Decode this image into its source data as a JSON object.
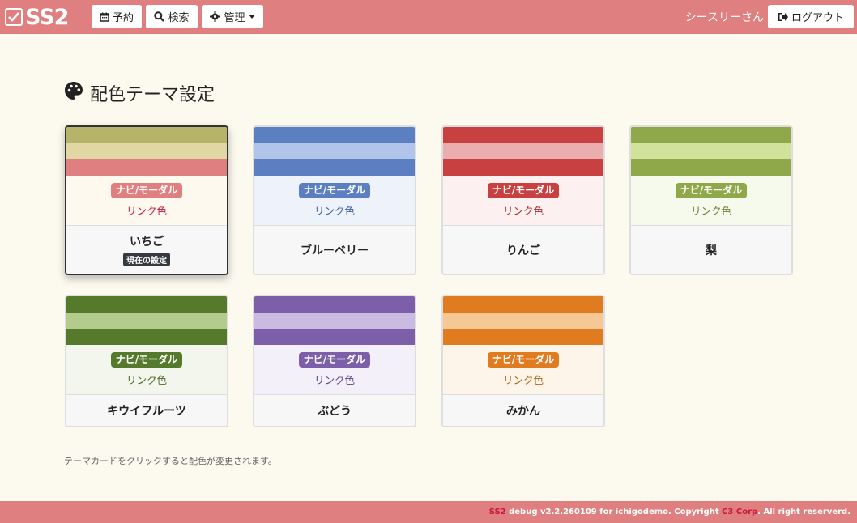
{
  "nav": {
    "logo_text": "SS2",
    "reserve_label": "予約",
    "search_label": "検索",
    "admin_label": "管理",
    "user_name": "シースリーさん",
    "logout_label": "ログアウト"
  },
  "page": {
    "title": "配色テーマ設定",
    "hint": "テーマカードをクリックすると配色が変更されます。"
  },
  "themes": [
    {
      "name": "いちご",
      "badge": "ナビ/モーダル",
      "link": "リンク色",
      "current_label": "現在の設定",
      "stripe1": "#b5b46a",
      "stripe2": "#e0d7a4",
      "stripe3": "#e07f80",
      "body_bg": "#fdf9ee",
      "badge_bg": "#e07f80",
      "link_color": "#c7183c"
    },
    {
      "name": "ブルーベリー",
      "badge": "ナビ/モーダル",
      "link": "リンク色",
      "stripe1": "#5b7fc1",
      "stripe2": "#b3c4ea",
      "stripe3": "#5b7fc1",
      "body_bg": "#eef2fb",
      "badge_bg": "#5b7fc1",
      "link_color": "#3e5f9a"
    },
    {
      "name": "りんご",
      "badge": "ナビ/モーダル",
      "link": "リンク色",
      "stripe1": "#c94040",
      "stripe2": "#ebaeae",
      "stripe3": "#c94040",
      "body_bg": "#fdf0f0",
      "badge_bg": "#c94040",
      "link_color": "#a82c2c"
    },
    {
      "name": "梨",
      "badge": "ナビ/モーダル",
      "link": "リンク色",
      "stripe1": "#8ea84a",
      "stripe2": "#d1e39a",
      "stripe3": "#8ea84a",
      "body_bg": "#f6faec",
      "badge_bg": "#8ea84a",
      "link_color": "#6a7e35"
    },
    {
      "name": "キウイフルーツ",
      "badge": "ナビ/モーダル",
      "link": "リンク色",
      "stripe1": "#567a2c",
      "stripe2": "#b3cc8e",
      "stripe3": "#567a2c",
      "body_bg": "#f2f6ec",
      "badge_bg": "#567a2c",
      "link_color": "#4a6a26"
    },
    {
      "name": "ぶどう",
      "badge": "ナビ/モーダル",
      "link": "リンク色",
      "stripe1": "#7c5fa8",
      "stripe2": "#cbbbe3",
      "stripe3": "#7c5fa8",
      "body_bg": "#f4f0fa",
      "badge_bg": "#7c5fa8",
      "link_color": "#5e4586"
    },
    {
      "name": "みかん",
      "badge": "ナビ/モーダル",
      "link": "リンク色",
      "stripe1": "#e07b20",
      "stripe2": "#f5c896",
      "stripe3": "#e07b20",
      "body_bg": "#fdf5ea",
      "badge_bg": "#e07b20",
      "link_color": "#b56114"
    }
  ],
  "footer": {
    "brand": "SS2",
    "text1": " debug v2.2.260109 for ichigodemo. Copyright ",
    "corp": "C3 Corp",
    "text2": ". All right reserverd."
  }
}
